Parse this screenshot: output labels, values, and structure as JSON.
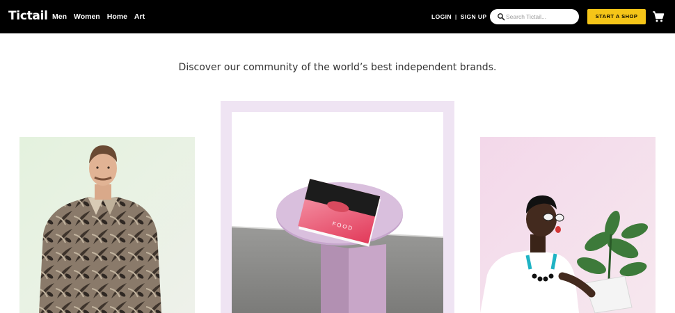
{
  "header": {
    "logo": "Tictail",
    "categories": [
      {
        "label": "Men"
      },
      {
        "label": "Women"
      },
      {
        "label": "Home"
      },
      {
        "label": "Art"
      }
    ],
    "login_label": "LOGIN",
    "separator": "|",
    "signup_label": "SIGN UP",
    "search": {
      "placeholder": "Search Tictail...",
      "value": "",
      "icon": "search-icon"
    },
    "start_shop_label": "START A SHOP",
    "cart_icon": "cart-icon"
  },
  "hero": {
    "tagline": "Discover our community of the world’s best independent brands."
  },
  "featured": {
    "magazine_cover_text": "FOOD"
  },
  "colors": {
    "nav_bg": "#000000",
    "accent": "#f5c518",
    "frame_lavender": "#efe4f3"
  }
}
